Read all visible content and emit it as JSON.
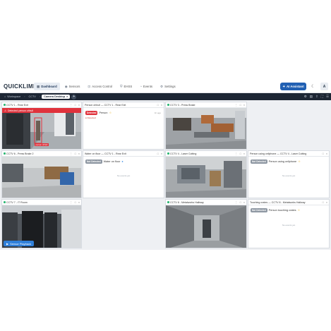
{
  "app": {
    "logo": "QUICKLIME",
    "nav": [
      {
        "label": "Dashboard",
        "icon": "grid-icon",
        "glyph": "▦",
        "active": true
      },
      {
        "label": "Sensors",
        "icon": "sensor-icon",
        "glyph": "◉",
        "active": false
      },
      {
        "label": "Access Control",
        "icon": "lock-icon",
        "glyph": "⊡",
        "active": false
      },
      {
        "label": "EHSS",
        "icon": "shield-icon",
        "glyph": "⛨",
        "active": false
      },
      {
        "label": "Events",
        "icon": "bell-icon",
        "glyph": "◔",
        "active": false
      },
      {
        "label": "Settings",
        "icon": "gear-icon",
        "glyph": "⚙",
        "active": false
      }
    ],
    "assistant_label": "AI Assistant"
  },
  "breadcrumbs": [
    "Workspace",
    "CCTV",
    "Camera Desktop"
  ],
  "panels": {
    "cam1": {
      "title": "CCTV 1 - Rear Exit",
      "alert": "Detected: person ohhull",
      "box_label": "person ohhull"
    },
    "evt1": {
      "title": "Person ohhull — CCTV 1 - Rear Exit",
      "tag": "Detected",
      "text": "Person",
      "time": "1h ago",
      "status": "● Detected"
    },
    "cam3": {
      "title": "CCTV 3 - Press Brake"
    },
    "cam6": {
      "title": "CCTV 6 - Press Brake 2"
    },
    "evt2": {
      "title": "Water on floor — CCTV 1 - Rear Exit",
      "tag": "Not Detected",
      "text": "Water on floor",
      "nodata": "No events yet"
    },
    "cam4": {
      "title": "CCTV 4 - Laser Cutting"
    },
    "evt3": {
      "title": "Person using cellphone — CCTV 4 - Laser Cutting",
      "tag": "Not Detected",
      "text": "Person using cellphone",
      "nodata": "No events yet"
    },
    "cam7": {
      "title": "CCTV 7 - IT Room",
      "playback": "Sensor Playback"
    },
    "cam8": {
      "title": "CCTV 8 - Metalworks Hallway"
    },
    "evt4": {
      "title": "Touching crates — CCTV 8 - Metalworks Hallway",
      "tag": "Not Detected",
      "text": "Person touching crates",
      "nodata": "No events yet"
    }
  },
  "colors": {
    "accent": "#2160b3",
    "alert": "#e0323c",
    "bar": "#1d2634"
  }
}
